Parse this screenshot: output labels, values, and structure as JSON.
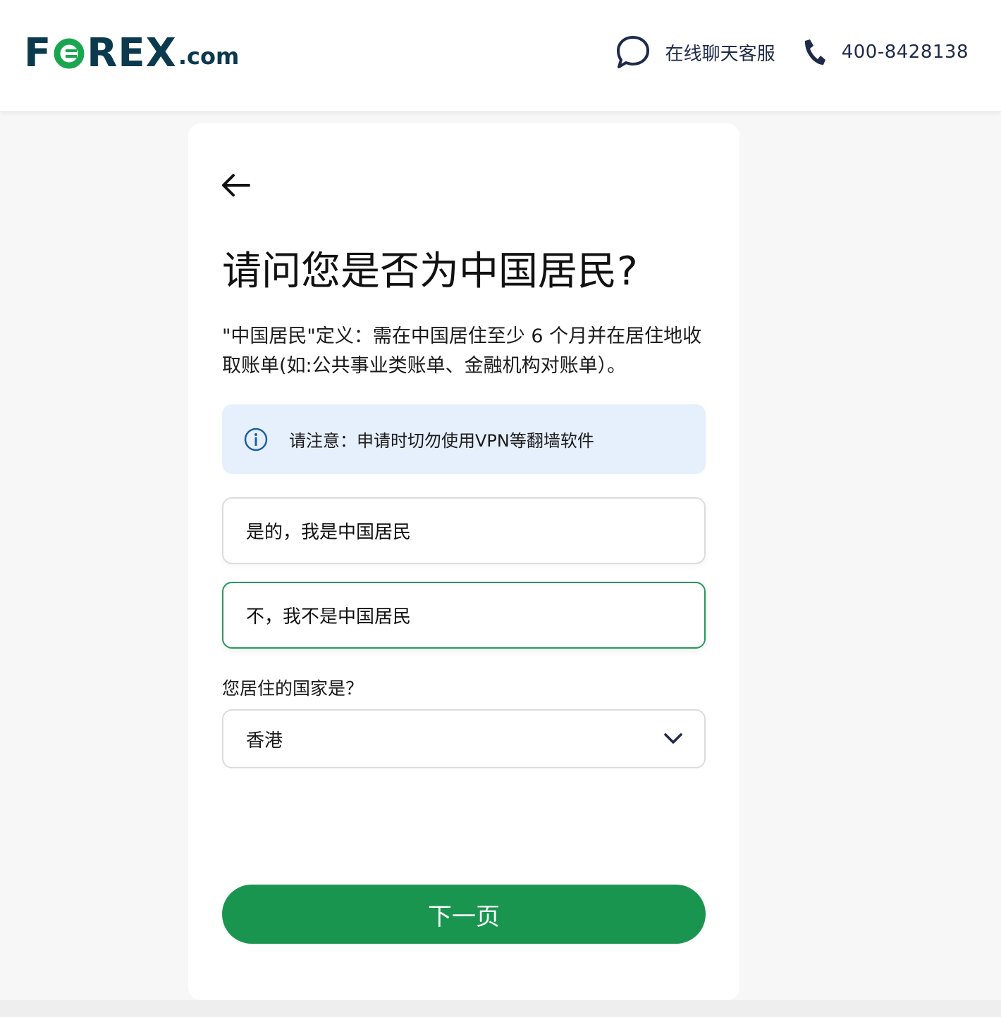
{
  "header": {
    "logo": {
      "main_prefix": "F",
      "main_suffix": "REX",
      "dotcom": ".com"
    },
    "chat_label": "在线聊天客服",
    "phone_label": "400-8428138"
  },
  "form": {
    "title": "请问您是否为中国居民?",
    "definition": "\"中国居民\"定义：需在中国居住至少 6 个月并在居住地收取账单(如:公共事业类账单、金融机构对账单）。",
    "notice": "请注意：申请时切勿使用VPN等翻墙软件",
    "options": [
      {
        "label": "是的，我是中国居民",
        "selected": false
      },
      {
        "label": "不，我不是中国居民",
        "selected": true
      }
    ],
    "country_question": "您居住的国家是？",
    "country_value": "香港",
    "next_label": "下一页"
  },
  "colors": {
    "brand_navy": "#0b3a4f",
    "brand_green": "#1a9550",
    "notice_bg": "#e6f0fd",
    "selected_border": "#27985a"
  }
}
